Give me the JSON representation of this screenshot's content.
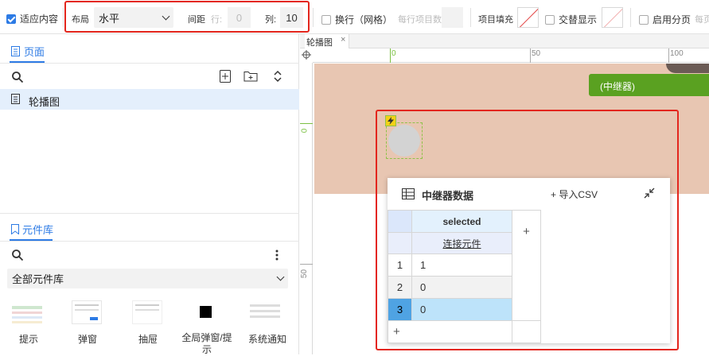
{
  "toolbar": {
    "fit_content": "适应内容",
    "layout_label": "布局",
    "layout_value": "水平",
    "spacing_label": "间距",
    "row_label": "行:",
    "row_value": "0",
    "col_label": "列:",
    "col_value": "10",
    "wrap_label": "换行（网格）",
    "per_row_label": "每行项目数",
    "item_fill_label": "项目填充",
    "alt_display_label": "交替显示",
    "pagination_label": "启用分页",
    "per_page_label": "每页"
  },
  "pages_panel": {
    "title": "页面",
    "items": [
      {
        "label": "轮播图",
        "selected": true
      }
    ]
  },
  "library_panel": {
    "title": "元件库",
    "filter_value": "全部元件库",
    "widgets": [
      {
        "label": "提示"
      },
      {
        "label": "弹窗"
      },
      {
        "label": "抽屉"
      },
      {
        "label": "全局弹窗/提示"
      },
      {
        "label": "系统通知"
      }
    ]
  },
  "canvas": {
    "tab_label": "轮播图",
    "ruler_h": [
      "0",
      "50",
      "100"
    ],
    "ruler_v": [
      "0",
      "50"
    ],
    "repeater_tag": "(中继器)"
  },
  "repeater_data": {
    "title": "中继器数据",
    "import_label": "+ 导入CSV",
    "column_name": "selected",
    "link_label": "连接元件",
    "add_col": "+",
    "add_row": "+",
    "rows": [
      {
        "index": "1",
        "value": "1"
      },
      {
        "index": "2",
        "value": "0"
      },
      {
        "index": "3",
        "value": "0"
      }
    ]
  },
  "colors": {
    "accent": "#2d7be5",
    "highlight": "#e3261d",
    "canvas_bg": "#e8c6b2",
    "repeater_tag": "#5aa121"
  }
}
